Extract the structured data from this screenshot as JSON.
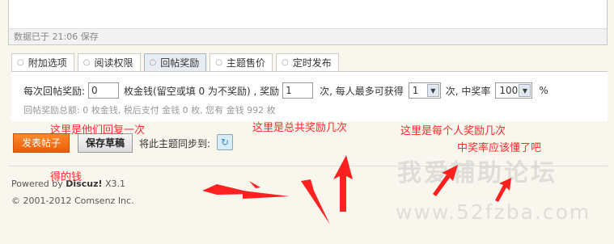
{
  "editor": {
    "status_text": "数据已于 21:06 保存"
  },
  "tabs": [
    {
      "label": "附加选项",
      "active": false
    },
    {
      "label": "阅读权限",
      "active": false
    },
    {
      "label": "回帖奖励",
      "active": true
    },
    {
      "label": "主题售价",
      "active": false
    },
    {
      "label": "定时发布",
      "active": false
    }
  ],
  "reward": {
    "label_per_reply": "每次回帖奖励:",
    "per_reply_value": "0",
    "label_money_hint": "枚金钱(留空或填 0 为不奖励) , 奖励",
    "times_value": "1",
    "label_times": "次, 每人最多可获得",
    "max_per_user": "1",
    "label_times2": "次, 中奖率",
    "rate": "100",
    "percent": "%",
    "summary": "回帖奖励总额: 0 枚金钱, 税后支付 金钱 0 枚, 您有 金钱 992 枚"
  },
  "actions": {
    "post_label": "发表帖子",
    "draft_label": "保存草稿",
    "sync_label": "将此主题同步到:"
  },
  "footer": {
    "powered_prefix": "Powered by",
    "powered_brand": "Discuz!",
    "powered_version": "X3.1",
    "copyright": "© 2001-2012 Comsenz Inc."
  },
  "annotations": {
    "note1": "这里是他们回复一次",
    "note1b": "得的钱",
    "note2": "这里是总共奖励几次",
    "note3": "这里是每个人奖励几次",
    "note4": "中奖率应该懂了吧"
  },
  "watermark": {
    "line1": "我爱辅助论坛",
    "line2": "www.52fzba.com"
  },
  "colors": {
    "annotation": "#ff2a2a",
    "primary_button": "#f0731a",
    "active_tab": "#e8edf3"
  }
}
